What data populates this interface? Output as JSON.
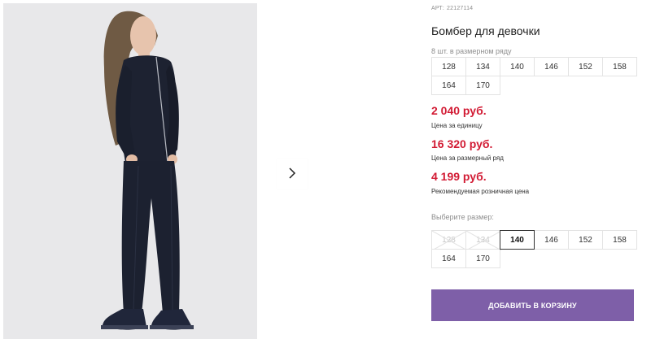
{
  "product": {
    "sku_label": "АРТ:",
    "sku_value": "22127114",
    "title": "Бомбер для девочки",
    "pack_label": "8 шт. в размерном ряду",
    "pack_sizes": [
      "128",
      "134",
      "140",
      "146",
      "152",
      "158",
      "164",
      "170"
    ]
  },
  "prices": {
    "unit_price": "2 040 руб.",
    "unit_label": "Цена за единицу",
    "pack_price": "16 320 руб.",
    "pack_label": "Цена за размерный ряд",
    "retail_price": "4 199 руб.",
    "retail_label": "Рекомендуемая розничная цена"
  },
  "size_select": {
    "label": "Выберите размер:",
    "options": [
      {
        "size": "128",
        "state": "disabled"
      },
      {
        "size": "134",
        "state": "disabled"
      },
      {
        "size": "140",
        "state": "selected"
      },
      {
        "size": "146",
        "state": "available"
      },
      {
        "size": "152",
        "state": "available"
      },
      {
        "size": "158",
        "state": "available"
      },
      {
        "size": "164",
        "state": "available"
      },
      {
        "size": "170",
        "state": "available"
      }
    ]
  },
  "actions": {
    "add_to_cart": "ДОБАВИТЬ В КОРЗИНУ"
  },
  "gallery": {
    "next_icon": "chevron-right-icon"
  },
  "colors": {
    "price": "#d21b34",
    "button": "#7e5fa8",
    "muted": "#8e8e8e"
  }
}
